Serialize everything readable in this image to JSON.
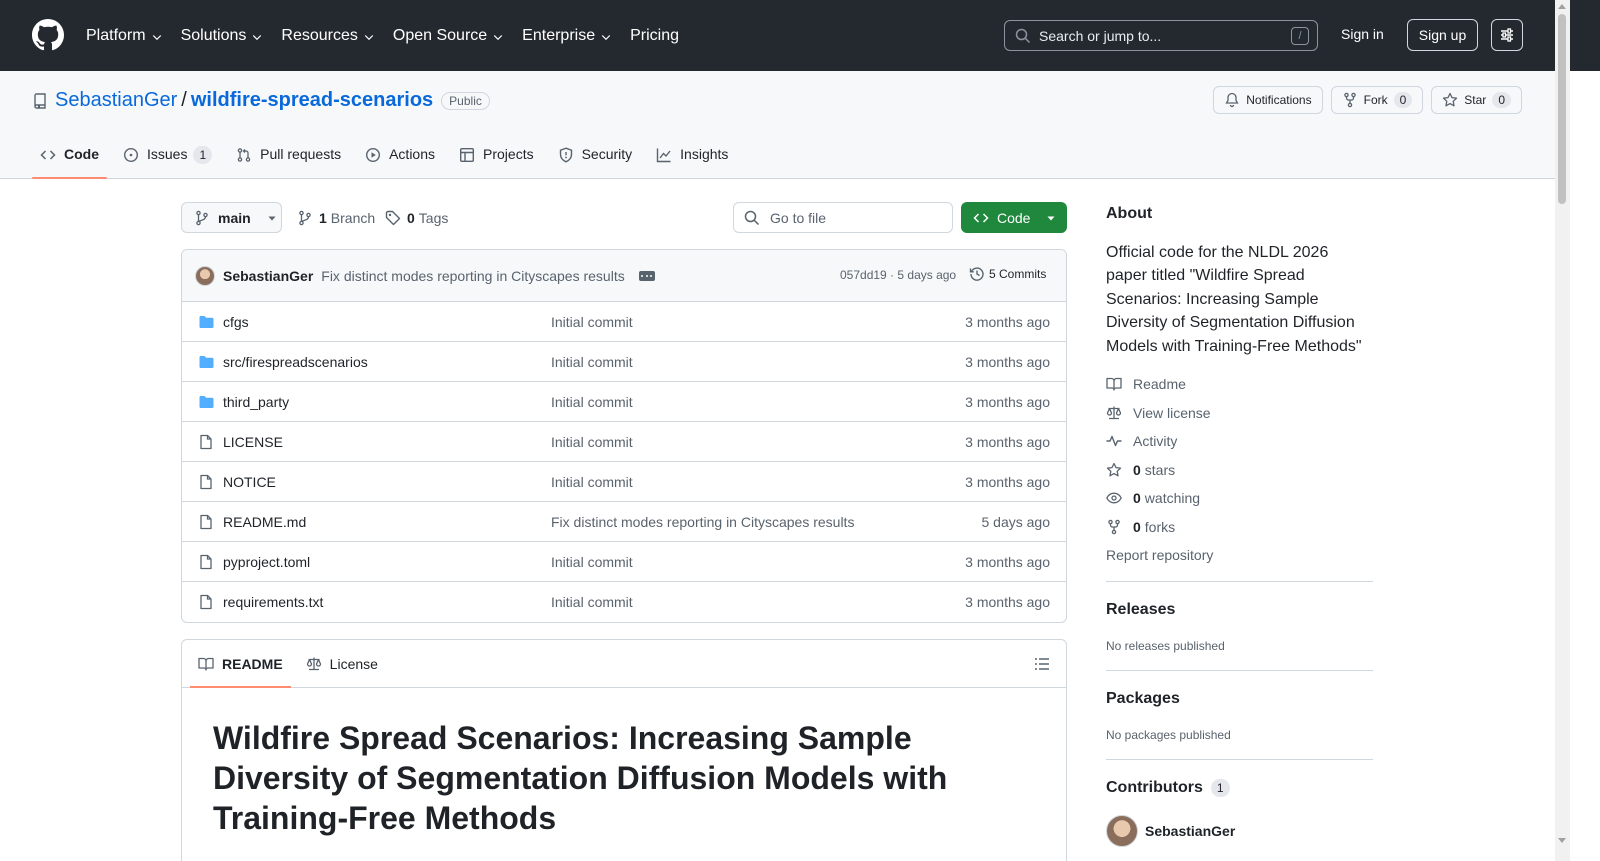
{
  "header": {
    "nav": [
      {
        "label": "Platform",
        "dropdown": true
      },
      {
        "label": "Solutions",
        "dropdown": true
      },
      {
        "label": "Resources",
        "dropdown": true
      },
      {
        "label": "Open Source",
        "dropdown": true
      },
      {
        "label": "Enterprise",
        "dropdown": true
      },
      {
        "label": "Pricing",
        "dropdown": false
      }
    ],
    "search_placeholder": "Search or jump to...",
    "search_key": "/",
    "sign_in": "Sign in",
    "sign_up": "Sign up"
  },
  "repo": {
    "owner": "SebastianGer",
    "separator": "/",
    "name": "wildfire-spread-scenarios",
    "visibility": "Public",
    "actions": {
      "notifications": "Notifications",
      "fork": "Fork",
      "fork_count": "0",
      "star": "Star",
      "star_count": "0"
    },
    "tabs": [
      {
        "label": "Code",
        "icon": "code-icon",
        "active": true
      },
      {
        "label": "Issues",
        "icon": "issue-icon",
        "count": "1"
      },
      {
        "label": "Pull requests",
        "icon": "pull-request-icon"
      },
      {
        "label": "Actions",
        "icon": "play-icon"
      },
      {
        "label": "Projects",
        "icon": "table-icon"
      },
      {
        "label": "Security",
        "icon": "shield-icon"
      },
      {
        "label": "Insights",
        "icon": "graph-icon"
      }
    ]
  },
  "browser": {
    "branch": "main",
    "branches_count": "1",
    "branches_label": "Branch",
    "tags_count": "0",
    "tags_label": "Tags",
    "go_to_file": "Go to file",
    "code_button": "Code",
    "latest_commit": {
      "author": "SebastianGer",
      "message": "Fix distinct modes reporting in Cityscapes results",
      "sha_time": "057dd19 · 5 days ago",
      "commits_label": "5 Commits"
    },
    "files": [
      {
        "type": "dir",
        "name": "cfgs",
        "message": "Initial commit",
        "date": "3 months ago"
      },
      {
        "type": "dir",
        "name": "src/firespreadscenarios",
        "message": "Initial commit",
        "date": "3 months ago"
      },
      {
        "type": "dir",
        "name": "third_party",
        "message": "Initial commit",
        "date": "3 months ago"
      },
      {
        "type": "file",
        "name": "LICENSE",
        "message": "Initial commit",
        "date": "3 months ago"
      },
      {
        "type": "file",
        "name": "NOTICE",
        "message": "Initial commit",
        "date": "3 months ago"
      },
      {
        "type": "file",
        "name": "README.md",
        "message": "Fix distinct modes reporting in Cityscapes results",
        "date": "5 days ago"
      },
      {
        "type": "file",
        "name": "pyproject.toml",
        "message": "Initial commit",
        "date": "3 months ago"
      },
      {
        "type": "file",
        "name": "requirements.txt",
        "message": "Initial commit",
        "date": "3 months ago"
      }
    ]
  },
  "readme": {
    "tab_readme": "README",
    "tab_license": "License",
    "title": "Wildfire Spread Scenarios: Increasing Sample Diversity of Segmentation Diffusion Models with Training-Free Methods"
  },
  "sidebar": {
    "about_title": "About",
    "description": "Official code for the NLDL 2026 paper titled \"Wildfire Spread Scenarios: Increasing Sample Diversity of Segmentation Diffusion Models with Training-Free Methods\"",
    "readme": "Readme",
    "license": "View license",
    "activity": "Activity",
    "stars_count": "0",
    "stars_label": "stars",
    "watching_count": "0",
    "watching_label": "watching",
    "forks_count": "0",
    "forks_label": "forks",
    "report": "Report repository",
    "releases_title": "Releases",
    "releases_empty": "No releases published",
    "packages_title": "Packages",
    "packages_empty": "No packages published",
    "contributors_title": "Contributors",
    "contributors_count": "1",
    "contributor_name": "SebastianGer"
  }
}
